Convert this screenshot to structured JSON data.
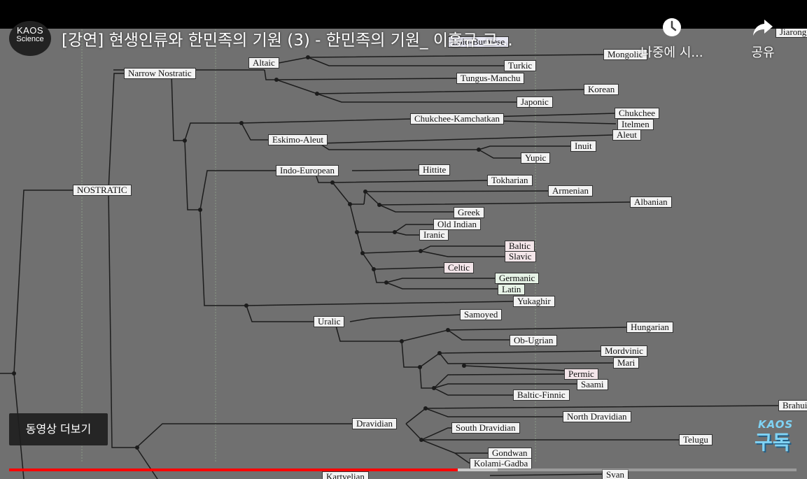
{
  "channel": {
    "logo_line1": "KAOS",
    "logo_line2": "Science"
  },
  "video": {
    "title": "[강연] 현생인류와 한민족의 기원 (3) - 한민족의 기원_ 이홍규 교..."
  },
  "controls": {
    "watch_later_label": "나중에 시...",
    "share_label": "공유",
    "more_videos_label": "동영상 더보기"
  },
  "subscribe_badge": {
    "line1": "KAOS",
    "line2": "구독"
  },
  "progress": {
    "played_fraction": 0.57,
    "buffered_fraction": 0.62
  },
  "colors": {
    "progress_played": "#ff0000",
    "slide_background": "#707070"
  },
  "tree_labels": {
    "nostratic": "NOSTRATIC",
    "narrow_nostratic": "Narrow Nostratic",
    "altaic": "Altaic",
    "mongolic": "Mongolic",
    "turkic": "Turkic",
    "tungus_manchu": "Tungus-Manchu",
    "korean": "Korean",
    "japonic": "Japonic",
    "lolo_burmese": "Lolo-Burmese",
    "jiarong": "Jiarong",
    "chukchee_kamchatkan": "Chukchee-Kamchatkan",
    "chukchee": "Chukchee",
    "itelmen": "Itelmen",
    "eskimo_aleut": "Eskimo-Aleut",
    "aleut": "Aleut",
    "inuit": "Inuit",
    "yupic": "Yupic",
    "indo_european": "Indo-European",
    "hittite": "Hittite",
    "tokharian": "Tokharian",
    "armenian": "Armenian",
    "albanian": "Albanian",
    "greek": "Greek",
    "old_indian": "Old Indian",
    "iranic": "Iranic",
    "baltic": "Baltic",
    "slavic": "Slavic",
    "celtic": "Celtic",
    "germanic": "Germanic",
    "latin": "Latin",
    "yukaghir": "Yukaghir",
    "uralic": "Uralic",
    "samoyed": "Samoyed",
    "hungarian": "Hungarian",
    "ob_ugrian": "Ob-Ugrian",
    "mordvinic": "Mordvinic",
    "mari": "Mari",
    "permic": "Permic",
    "saami": "Saami",
    "baltic_finnic": "Baltic-Finnic",
    "dravidian": "Dravidian",
    "brahui": "Brahui",
    "north_dravidian": "North Dravidian",
    "south_dravidian": "South Dravidian",
    "telugu": "Telugu",
    "gondwan": "Gondwan",
    "kolami_gadba": "Kolami-Gadba",
    "kartvelian": "Kartvelian",
    "svan": "Svan"
  }
}
